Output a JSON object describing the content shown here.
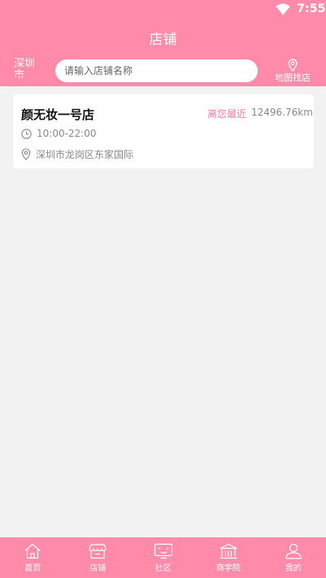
{
  "status_bar": {
    "time": "7:55"
  },
  "header": {
    "title": "店铺",
    "city": "深圳市",
    "search_placeholder": "请输入店铺名称",
    "map_label": "地图找店"
  },
  "stores": [
    {
      "name": "颜无妆一号店",
      "distance_tag": "离您最近",
      "distance": "12496.76km",
      "hours": "10:00-22:00",
      "address": "深圳市龙岗区东家国际"
    }
  ],
  "tabbar": {
    "items": [
      {
        "label": "首页",
        "icon": "home-icon"
      },
      {
        "label": "店铺",
        "icon": "store-icon"
      },
      {
        "label": "社区",
        "icon": "community-icon"
      },
      {
        "label": "商学院",
        "icon": "academy-icon"
      },
      {
        "label": "我的",
        "icon": "user-icon"
      }
    ]
  },
  "colors": {
    "brand": "#ff8aa9",
    "accent_text": "#f07fa0",
    "background": "#f2f2f2"
  }
}
